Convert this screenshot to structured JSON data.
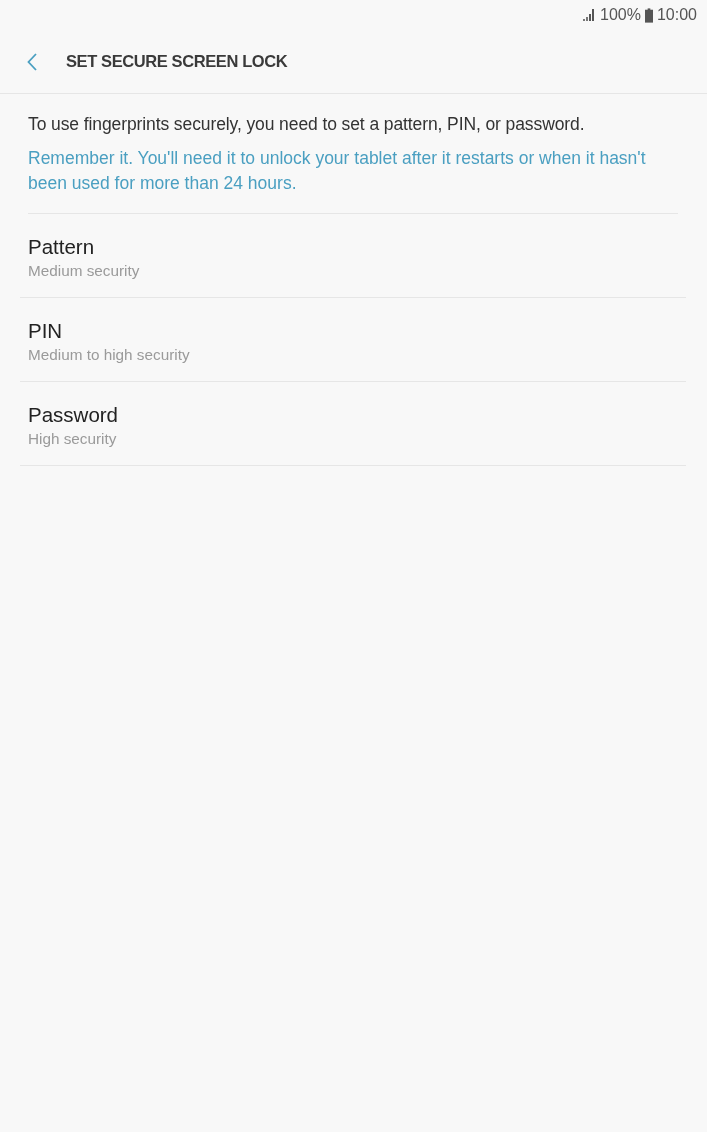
{
  "status_bar": {
    "battery": "100%",
    "time": "10:00"
  },
  "header": {
    "title": "SET SECURE SCREEN LOCK"
  },
  "intro": {
    "text": "To use fingerprints securely, you need to set a pattern, PIN, or password.",
    "note": "Remember it. You'll need it to unlock your tablet after it restarts or when it hasn't been used for more than 24 hours."
  },
  "options": [
    {
      "title": "Pattern",
      "subtitle": "Medium security"
    },
    {
      "title": "PIN",
      "subtitle": "Medium to high security"
    },
    {
      "title": "Password",
      "subtitle": "High security"
    }
  ]
}
